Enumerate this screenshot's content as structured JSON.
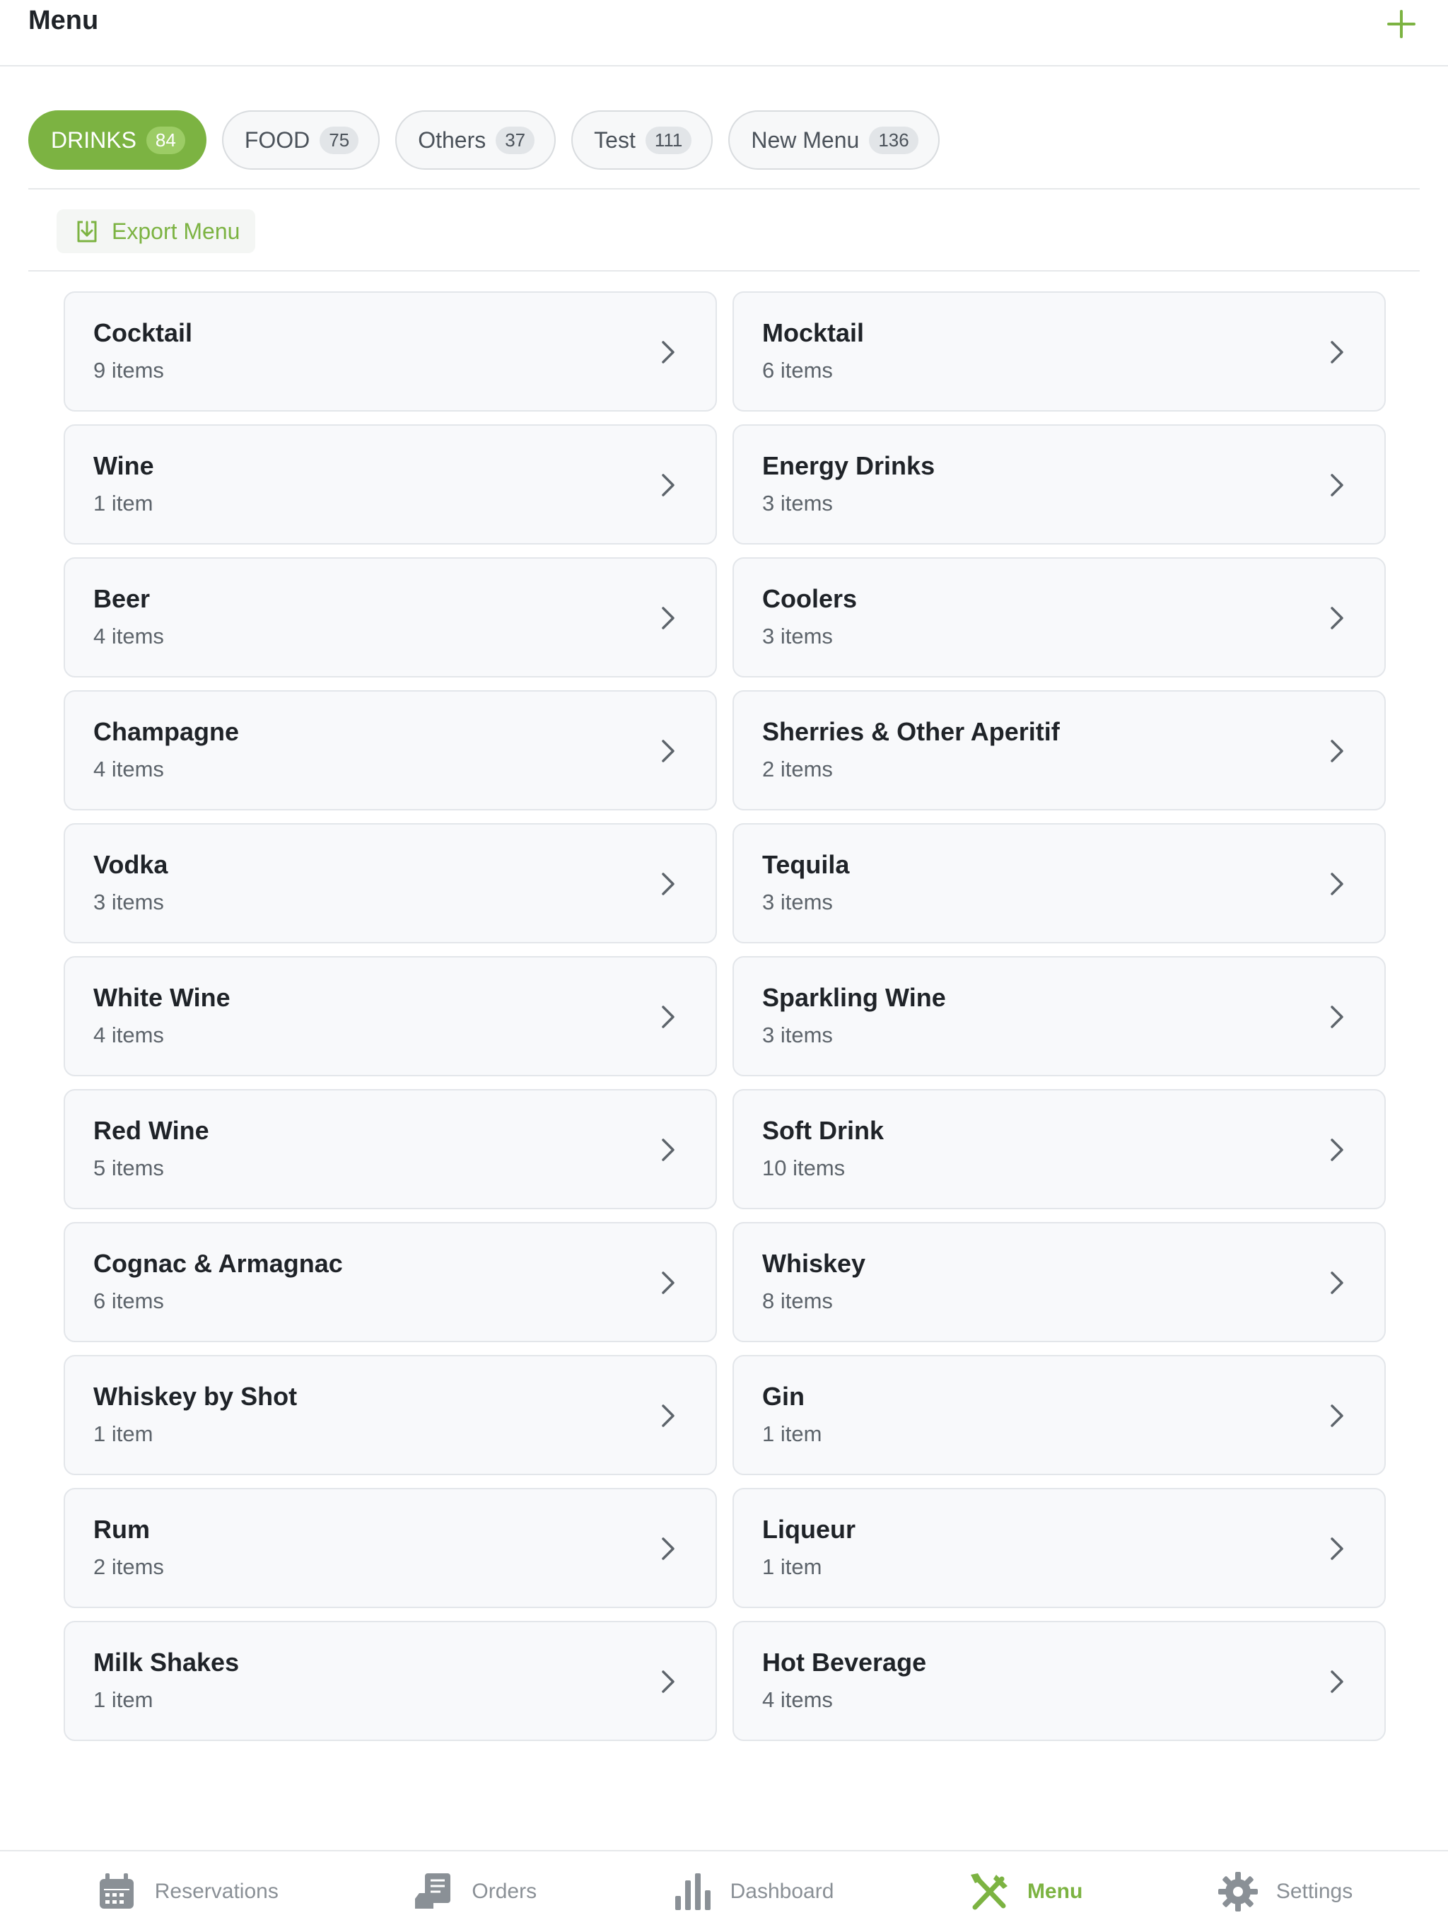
{
  "header": {
    "title": "Menu",
    "add_icon": "plus-icon"
  },
  "tabs": [
    {
      "label": "DRINKS",
      "count": "84",
      "active": true
    },
    {
      "label": "FOOD",
      "count": "75",
      "active": false
    },
    {
      "label": "Others",
      "count": "37",
      "active": false
    },
    {
      "label": "Test",
      "count": "111",
      "active": false
    },
    {
      "label": "New Menu",
      "count": "136",
      "active": false
    }
  ],
  "export": {
    "label": "Export Menu",
    "icon": "download-icon"
  },
  "categories": [
    {
      "name": "Cocktail",
      "count": "9 items"
    },
    {
      "name": "Mocktail",
      "count": "6 items"
    },
    {
      "name": "Wine",
      "count": "1 item"
    },
    {
      "name": "Energy Drinks",
      "count": "3 items"
    },
    {
      "name": "Beer",
      "count": "4 items"
    },
    {
      "name": "Coolers",
      "count": "3 items"
    },
    {
      "name": "Champagne",
      "count": "4 items"
    },
    {
      "name": "Sherries & Other Aperitif",
      "count": "2 items"
    },
    {
      "name": "Vodka",
      "count": "3 items"
    },
    {
      "name": "Tequila",
      "count": "3 items"
    },
    {
      "name": "White Wine",
      "count": "4 items"
    },
    {
      "name": "Sparkling Wine",
      "count": "3 items"
    },
    {
      "name": "Red Wine",
      "count": "5 items"
    },
    {
      "name": "Soft Drink",
      "count": "10 items"
    },
    {
      "name": "Cognac & Armagnac",
      "count": "6 items"
    },
    {
      "name": "Whiskey",
      "count": "8 items"
    },
    {
      "name": "Whiskey by Shot",
      "count": "1 item"
    },
    {
      "name": "Gin",
      "count": "1 item"
    },
    {
      "name": "Rum",
      "count": "2 items"
    },
    {
      "name": "Liqueur",
      "count": "1 item"
    },
    {
      "name": "Milk Shakes",
      "count": "1 item"
    },
    {
      "name": "Hot Beverage",
      "count": "4 items"
    }
  ],
  "bottom_nav": [
    {
      "label": "Reservations",
      "icon": "calendar-icon",
      "active": false
    },
    {
      "label": "Orders",
      "icon": "orders-icon",
      "active": false
    },
    {
      "label": "Dashboard",
      "icon": "bar-chart-icon",
      "active": false
    },
    {
      "label": "Menu",
      "icon": "utensils-icon",
      "active": true
    },
    {
      "label": "Settings",
      "icon": "gear-icon",
      "active": false
    }
  ],
  "colors": {
    "accent": "#7cb342",
    "inactive": "#8a9096",
    "card_bg": "#f8f9fb"
  }
}
